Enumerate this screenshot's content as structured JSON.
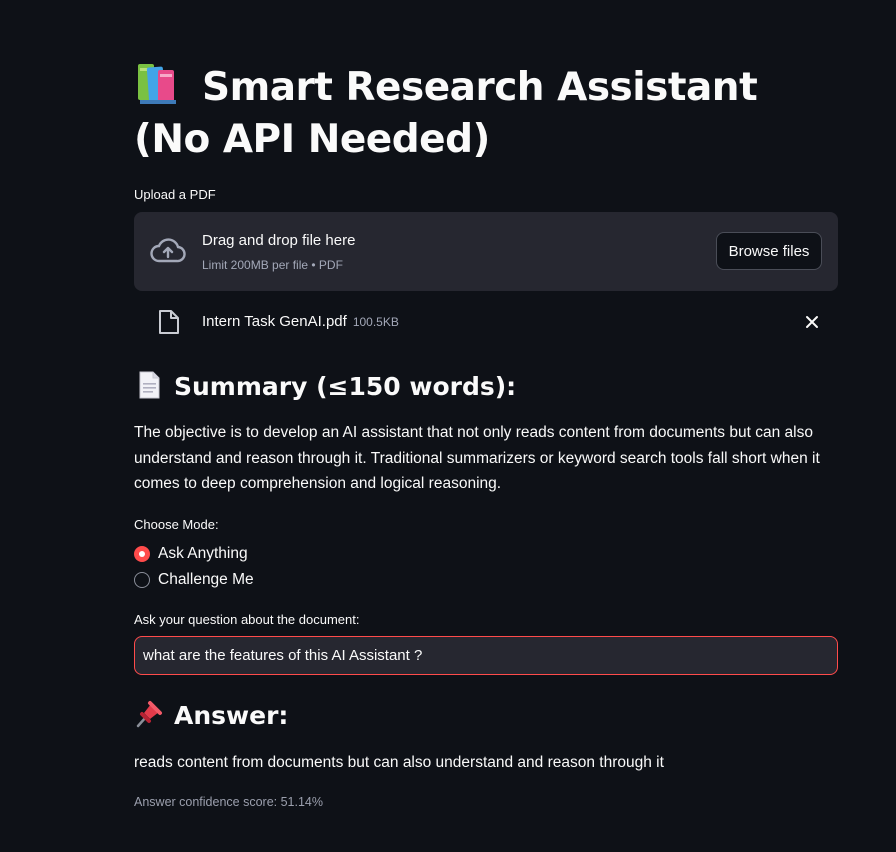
{
  "page": {
    "title": "Smart Research Assistant (No API Needed)",
    "title_icon": "books-emoji-icon"
  },
  "uploader": {
    "label": "Upload a PDF",
    "drag_text": "Drag and drop file here",
    "limit_text": "Limit 200MB per file • PDF",
    "browse_label": "Browse files",
    "file": {
      "name": "Intern Task GenAI.pdf",
      "size": "100.5KB"
    }
  },
  "summary": {
    "heading": "Summary (≤150 words):",
    "icon": "page-facing-up-emoji-icon",
    "text": "The objective is to develop an AI assistant that not only reads content from documents but can also understand and reason through it. Traditional summarizers or keyword search tools fall short when it comes to deep comprehension and logical reasoning."
  },
  "mode": {
    "label": "Choose Mode:",
    "options": [
      "Ask Anything",
      "Challenge Me"
    ],
    "selected": "Ask Anything"
  },
  "question": {
    "label": "Ask your question about the document:",
    "value": "what are the features of this AI Assistant ?"
  },
  "answer": {
    "heading": "Answer:",
    "icon": "pushpin-emoji-icon",
    "text": "reads content from documents but can also understand and reason through it",
    "confidence": "Answer confidence score: 51.14%"
  },
  "colors": {
    "background": "#0e1117",
    "surface": "#262730",
    "accent": "#ff4b4b",
    "text": "#fafafa",
    "muted": "#a3a8b8"
  }
}
